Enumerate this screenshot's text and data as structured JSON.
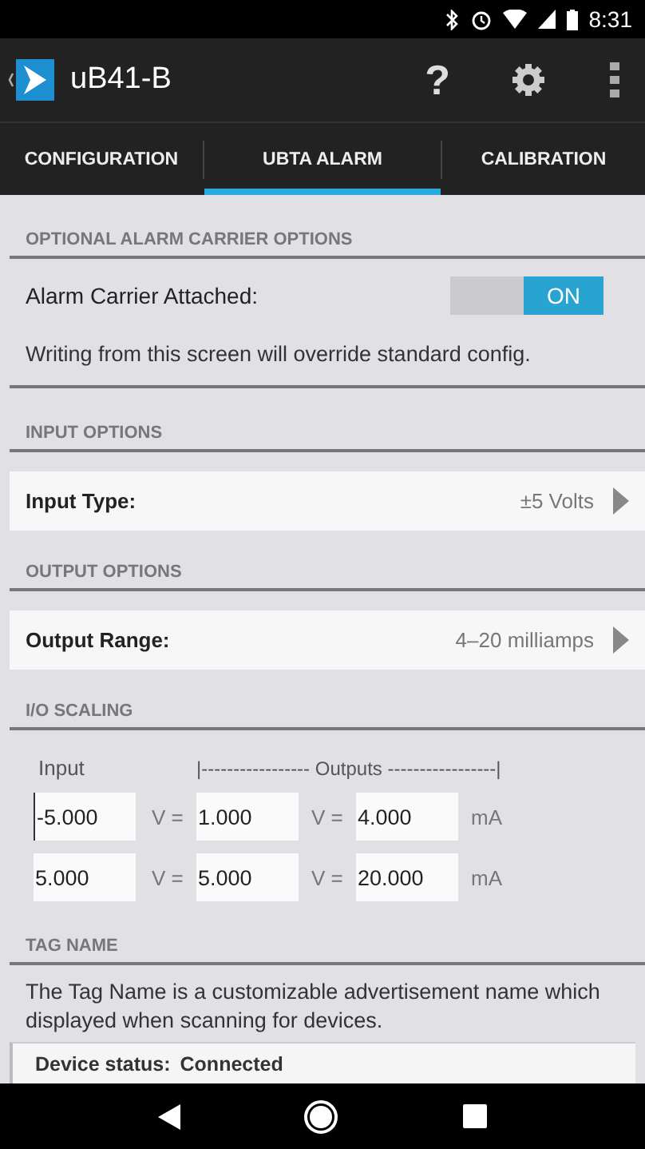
{
  "status_bar": {
    "time": "8:31"
  },
  "app_bar": {
    "title": "uB41-B",
    "help": "?"
  },
  "tabs": [
    {
      "label": "CONFIGURATION",
      "selected": false
    },
    {
      "label": "UBTA ALARM",
      "selected": true
    },
    {
      "label": "CALIBRATION",
      "selected": false
    }
  ],
  "alarm_section": {
    "header": "OPTIONAL ALARM CARRIER OPTIONS",
    "toggle_label": "Alarm Carrier Attached:",
    "toggle": {
      "on": true,
      "label": "ON"
    },
    "note": "Writing from this screen will override standard config."
  },
  "input_section": {
    "header": "INPUT OPTIONS",
    "label": "Input Type:",
    "value": "±5 Volts"
  },
  "output_section": {
    "header": "OUTPUT OPTIONS",
    "label": "Output Range:",
    "value": "4–20 milliamps"
  },
  "scaling": {
    "header": "I/O SCALING",
    "input_heading": "Input",
    "outputs_heading": "|----------------- Outputs -----------------|",
    "rows": [
      {
        "input": "-5.000",
        "focused": true,
        "sep1": "V =",
        "volts": "1.000",
        "sep2": "V =",
        "current": "4.000",
        "unit": "mA"
      },
      {
        "input": "5.000",
        "focused": false,
        "sep1": "V =",
        "volts": "5.000",
        "sep2": "V =",
        "current": "20.000",
        "unit": "mA"
      }
    ]
  },
  "tag_section": {
    "header": "TAG NAME",
    "text": "The Tag Name is a customizable advertisement name which displayed when scanning for devices."
  },
  "device_status": {
    "label": "Device status:",
    "value": "Connected"
  }
}
